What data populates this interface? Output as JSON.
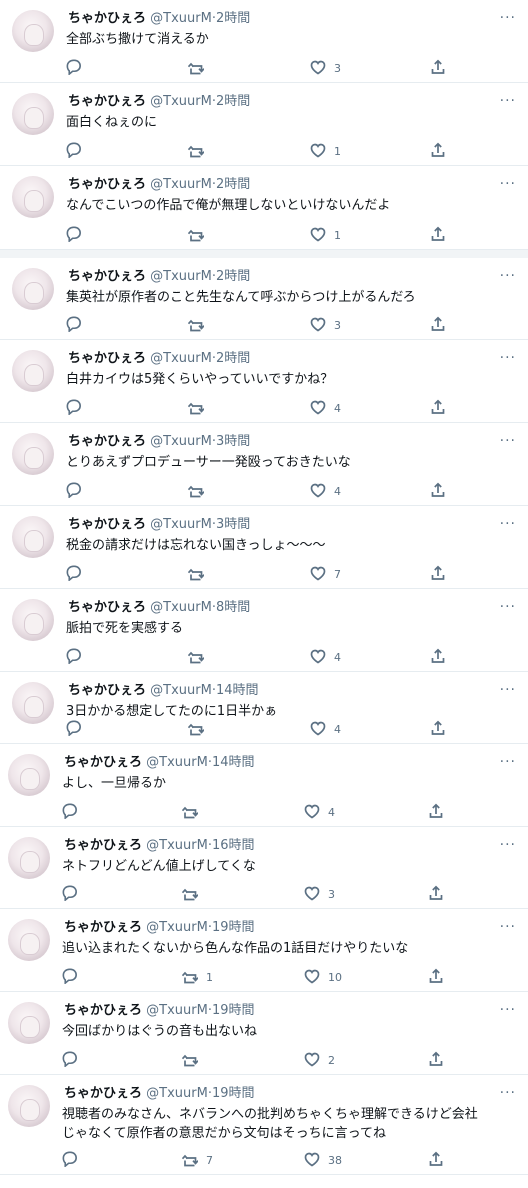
{
  "icons": {
    "reply": "reply-icon",
    "retweet": "retweet-icon",
    "like": "heart-icon",
    "share": "share-icon",
    "more": "more-icon"
  },
  "more_label": "···",
  "tweets": [
    {
      "name": "ちゃかひぇろ",
      "handle": "@TxuurM",
      "dot": "·",
      "time": "2時間",
      "text": "全部ぶち撒けて消えるか",
      "retweets": "",
      "likes": "3"
    },
    {
      "name": "ちゃかひぇろ",
      "handle": "@TxuurM",
      "dot": "·",
      "time": "2時間",
      "text": "面白くねぇのに",
      "retweets": "",
      "likes": "1"
    },
    {
      "name": "ちゃかひぇろ",
      "handle": "@TxuurM",
      "dot": "·",
      "time": "2時間",
      "text": "なんでこいつの作品で俺が無理しないといけないんだよ",
      "retweets": "",
      "likes": "1"
    },
    {
      "name": "ちゃかひぇろ",
      "handle": "@TxuurM",
      "dot": "·",
      "time": "2時間",
      "text": "集英社が原作者のこと先生なんて呼ぶからつけ上がるんだろ",
      "retweets": "",
      "likes": "3"
    },
    {
      "name": "ちゃかひぇろ",
      "handle": "@TxuurM",
      "dot": "·",
      "time": "2時間",
      "text": "白井カイウは5発くらいやっていいですかね？",
      "retweets": "",
      "likes": "4"
    },
    {
      "name": "ちゃかひぇろ",
      "handle": "@TxuurM",
      "dot": "·",
      "time": "3時間",
      "text": "とりあえずプロデューサー一発殴っておきたいな",
      "retweets": "",
      "likes": "4"
    },
    {
      "name": "ちゃかひぇろ",
      "handle": "@TxuurM",
      "dot": "·",
      "time": "3時間",
      "text": "税金の請求だけは忘れない国きっしょ〜〜〜",
      "retweets": "",
      "likes": "7"
    },
    {
      "name": "ちゃかひぇろ",
      "handle": "@TxuurM",
      "dot": "·",
      "time": "8時間",
      "text": "脈拍で死を実感する",
      "retweets": "",
      "likes": "4"
    },
    {
      "name": "ちゃかひぇろ",
      "handle": "@TxuurM",
      "dot": "·",
      "time": "14時間",
      "text": "3日かかる想定してたのに1日半かぁ",
      "retweets": "",
      "likes": "4"
    },
    {
      "name": "ちゃかひぇろ",
      "handle": "@TxuurM",
      "dot": "·",
      "time": "14時間",
      "text": "よし、一旦帰るか",
      "retweets": "",
      "likes": "4"
    },
    {
      "name": "ちゃかひぇろ",
      "handle": "@TxuurM",
      "dot": "·",
      "time": "16時間",
      "text": "ネトフリどんどん値上げしてくな",
      "retweets": "",
      "likes": "3"
    },
    {
      "name": "ちゃかひぇろ",
      "handle": "@TxuurM",
      "dot": "·",
      "time": "19時間",
      "text": "追い込まれたくないから色んな作品の1話目だけやりたいな",
      "retweets": "1",
      "likes": "10"
    },
    {
      "name": "ちゃかひぇろ",
      "handle": "@TxuurM",
      "dot": "·",
      "time": "19時間",
      "text": "今回ばかりはぐうの音も出ないね",
      "retweets": "",
      "likes": "2"
    },
    {
      "name": "ちゃかひぇろ",
      "handle": "@TxuurM",
      "dot": "·",
      "time": "19時間",
      "text": "視聴者のみなさん、ネバランへの批判めちゃくちゃ理解できるけど会社\nじゃなくて原作者の意思だから文句はそっちに言ってね",
      "retweets": "7",
      "likes": "38"
    }
  ]
}
